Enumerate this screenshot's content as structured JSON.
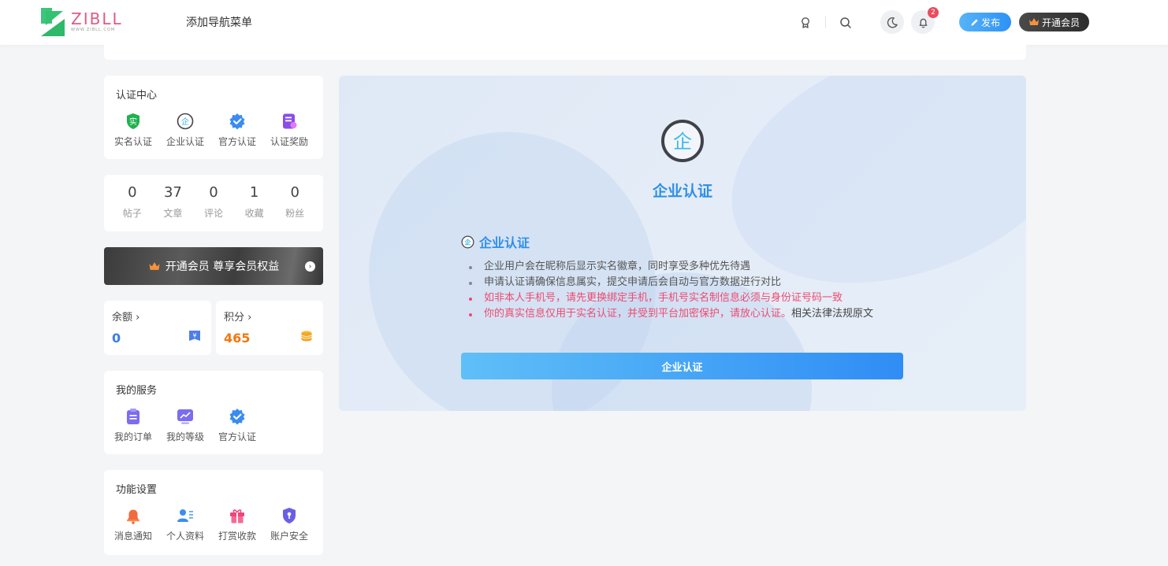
{
  "header": {
    "logo_word": "ZIBLL",
    "logo_sub": "WWW.ZIBLL.COM",
    "nav_label": "添加导航菜单",
    "notification_count": "2",
    "publish_label": "发布",
    "vip_label": "开通会员"
  },
  "auth_center": {
    "title": "认证中心",
    "items": [
      {
        "label": "实名认证",
        "icon": "real-name-icon"
      },
      {
        "label": "企业认证",
        "icon": "enterprise-icon"
      },
      {
        "label": "官方认证",
        "icon": "official-verified-icon"
      },
      {
        "label": "认证奖励",
        "icon": "reward-icon"
      }
    ]
  },
  "stats": [
    {
      "value": "0",
      "label": "帖子"
    },
    {
      "value": "37",
      "label": "文章"
    },
    {
      "value": "0",
      "label": "评论"
    },
    {
      "value": "1",
      "label": "收藏"
    },
    {
      "value": "0",
      "label": "粉丝"
    }
  ],
  "vip_banner": {
    "label": "开通会员 尊享会员权益"
  },
  "wallet": {
    "balance_label": "余额 ›",
    "balance_value": "0",
    "points_label": "积分 ›",
    "points_value": "465"
  },
  "services": {
    "title": "我的服务",
    "items": [
      {
        "label": "我的订单",
        "icon": "order-icon"
      },
      {
        "label": "我的等级",
        "icon": "level-icon"
      },
      {
        "label": "官方认证",
        "icon": "official-verified-icon"
      }
    ]
  },
  "settings": {
    "title": "功能设置",
    "items": [
      {
        "label": "消息通知",
        "icon": "bell-icon"
      },
      {
        "label": "个人资料",
        "icon": "profile-icon"
      },
      {
        "label": "打赏收款",
        "icon": "gift-icon"
      },
      {
        "label": "账户安全",
        "icon": "shield-icon"
      }
    ]
  },
  "main": {
    "title": "企业认证",
    "section_title": "企业认证",
    "notes": [
      "企业用户会在昵称后显示实名徽章，同时享受多种优先待遇",
      "申请认证请确保信息属实，提交申请后会自动与官方数据进行对比",
      "如非本人手机号，请先更换绑定手机，手机号实名制信息必须与身份证号码一致",
      "你的真实信息仅用于实名认证，并受到平台加密保护，请放心认证。"
    ],
    "law_link": "相关法律法规原文",
    "submit_label": "企业认证"
  },
  "colors": {
    "accent": "#2f8fe8",
    "warning": "#ee4a6e",
    "points": "#f0780f",
    "balance": "#3a7be6"
  }
}
